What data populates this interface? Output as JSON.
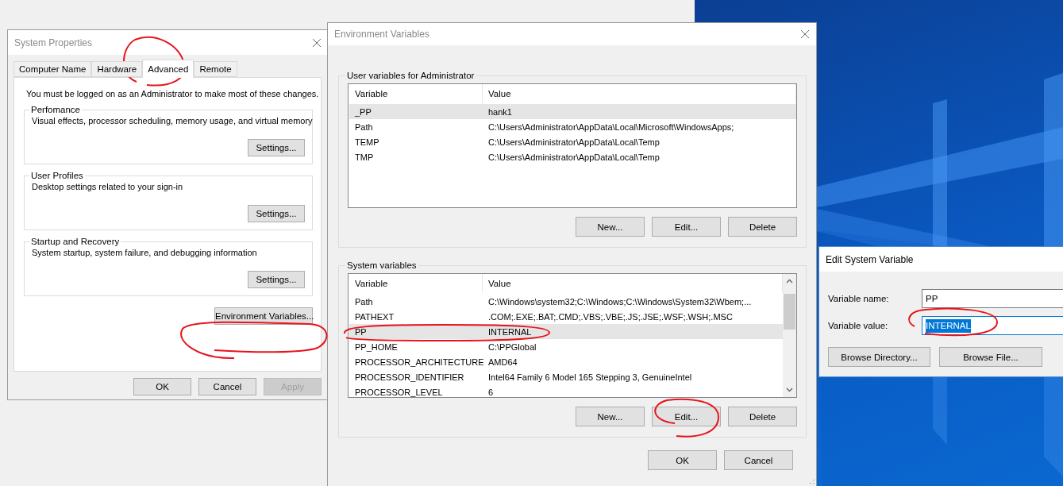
{
  "system_properties": {
    "title": "System Properties",
    "tabs": [
      {
        "label": "Computer Name",
        "selected": false
      },
      {
        "label": "Hardware",
        "selected": false
      },
      {
        "label": "Advanced",
        "selected": true
      },
      {
        "label": "Remote",
        "selected": false
      }
    ],
    "notice": "You must be logged on as an Administrator to make most of these changes.",
    "groups": [
      {
        "title": "Perfomance",
        "description": "Visual effects, processor scheduling, memory usage, and virtual memory",
        "button": "Settings..."
      },
      {
        "title": "User Profiles",
        "description": "Desktop settings related to your sign-in",
        "button": "Settings..."
      },
      {
        "title": "Startup and Recovery",
        "description": "System startup, system failure, and debugging information",
        "button": "Settings..."
      }
    ],
    "environment_button": "Environment Variables...",
    "buttons": [
      {
        "label": "OK",
        "disabled": false
      },
      {
        "label": "Cancel",
        "disabled": false
      },
      {
        "label": "Apply",
        "disabled": true
      }
    ]
  },
  "environment_variables": {
    "title": "Environment Variables",
    "sections": [
      {
        "title": "User variables for Administrator",
        "scrollable": false,
        "columns": [
          "Variable",
          "Value"
        ],
        "rows": [
          {
            "variable": "_PP",
            "value": "hank1",
            "selected": true
          },
          {
            "variable": "Path",
            "value": "C:\\Users\\Administrator\\AppData\\Local\\Microsoft\\WindowsApps;",
            "selected": false
          },
          {
            "variable": "TEMP",
            "value": "C:\\Users\\Administrator\\AppData\\Local\\Temp",
            "selected": false
          },
          {
            "variable": "TMP",
            "value": "C:\\Users\\Administrator\\AppData\\Local\\Temp",
            "selected": false
          }
        ],
        "buttons": [
          "New...",
          "Edit...",
          "Delete"
        ]
      },
      {
        "title": "System variables",
        "scrollable": true,
        "columns": [
          "Variable",
          "Value"
        ],
        "rows": [
          {
            "variable": "Path",
            "value": "C:\\Windows\\system32;C:\\Windows;C:\\Windows\\System32\\Wbem;...",
            "selected": false
          },
          {
            "variable": "PATHEXT",
            "value": ".COM;.EXE;.BAT;.CMD;.VBS;.VBE;.JS;.JSE;.WSF;.WSH;.MSC",
            "selected": false
          },
          {
            "variable": "PP",
            "value": "INTERNAL",
            "selected": true
          },
          {
            "variable": "PP_HOME",
            "value": "C:\\PPGlobal",
            "selected": false
          },
          {
            "variable": "PROCESSOR_ARCHITECTURE",
            "value": "AMD64",
            "selected": false
          },
          {
            "variable": "PROCESSOR_IDENTIFIER",
            "value": "Intel64 Family 6 Model 165 Stepping 3, GenuineIntel",
            "selected": false
          },
          {
            "variable": "PROCESSOR_LEVEL",
            "value": "6",
            "selected": false
          }
        ],
        "buttons": [
          "New...",
          "Edit...",
          "Delete"
        ]
      }
    ],
    "buttons": [
      "OK",
      "Cancel"
    ]
  },
  "edit_variable": {
    "title": "Edit System Variable",
    "fields": [
      {
        "label": "Variable name:",
        "value": "PP",
        "focused": false,
        "text_selected": false
      },
      {
        "label": "Variable value:",
        "value": "INTERNAL",
        "focused": true,
        "text_selected": true
      }
    ],
    "buttons": [
      "Browse Directory...",
      "Browse File..."
    ]
  }
}
